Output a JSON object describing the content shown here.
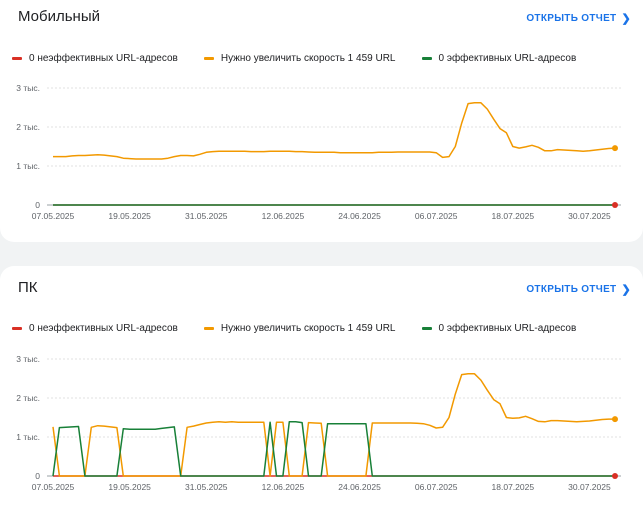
{
  "colors": {
    "red": "#d93025",
    "orange": "#f29900",
    "green": "#188038",
    "link": "#1a73e8"
  },
  "cards": [
    {
      "title": "Мобильный",
      "open_report": "ОТКРЫТЬ ОТЧЕТ",
      "legend": [
        {
          "label": "0 неэффективных URL-адресов",
          "color": "#d93025"
        },
        {
          "label": "Нужно увеличить скорость 1 459 URL",
          "color": "#f29900"
        },
        {
          "label": "0 эффективных URL-адресов",
          "color": "#188038"
        }
      ]
    },
    {
      "title": "ПК",
      "open_report": "ОТКРЫТЬ ОТЧЕТ",
      "legend": [
        {
          "label": "0 неэффективных URL-адресов",
          "color": "#d93025"
        },
        {
          "label": "Нужно увеличить скорость 1 459 URL",
          "color": "#f29900"
        },
        {
          "label": "0 эффективных URL-адресов",
          "color": "#188038"
        }
      ]
    }
  ],
  "chart_data": [
    {
      "type": "line",
      "ylim": [
        0,
        3000
      ],
      "y_ticks": [
        {
          "value": 0,
          "label": "0"
        },
        {
          "value": 1000,
          "label": "1 тыс."
        },
        {
          "value": 2000,
          "label": "2 тыс."
        },
        {
          "value": 3000,
          "label": "3 тыс."
        }
      ],
      "x_tick_labels": [
        "07.05.2025",
        "19.05.2025",
        "31.05.2025",
        "12.06.2025",
        "24.06.2025",
        "06.07.2025",
        "18.07.2025",
        "30.07.2025"
      ],
      "x_tick_index": [
        0,
        12,
        24,
        36,
        48,
        60,
        72,
        84
      ],
      "n_points": 89,
      "series": [
        {
          "name": "0 неэффективных URL-адресов",
          "color": "#d93025",
          "values": [
            0,
            0,
            0,
            0,
            0,
            0,
            0,
            0,
            0,
            0,
            0,
            0,
            0,
            0,
            0,
            0,
            0,
            0,
            0,
            0,
            0,
            0,
            0,
            0,
            0,
            0,
            0,
            0,
            0,
            0,
            0,
            0,
            0,
            0,
            0,
            0,
            0,
            0,
            0,
            0,
            0,
            0,
            0,
            0,
            0,
            0,
            0,
            0,
            0,
            0,
            0,
            0,
            0,
            0,
            0,
            0,
            0,
            0,
            0,
            0,
            0,
            0,
            0,
            0,
            0,
            0,
            0,
            0,
            0,
            0,
            0,
            0,
            0,
            0,
            0,
            0,
            0,
            0,
            0,
            0,
            0,
            0,
            0,
            0,
            0,
            0,
            0,
            0,
            0
          ]
        },
        {
          "name": "Нужно увеличить скорость 1 459 URL",
          "color": "#f29900",
          "values": [
            1240,
            1240,
            1240,
            1260,
            1270,
            1270,
            1280,
            1290,
            1280,
            1260,
            1240,
            1200,
            1190,
            1180,
            1180,
            1180,
            1180,
            1180,
            1200,
            1240,
            1270,
            1270,
            1260,
            1300,
            1350,
            1370,
            1380,
            1380,
            1380,
            1380,
            1380,
            1370,
            1370,
            1370,
            1380,
            1380,
            1380,
            1380,
            1370,
            1370,
            1360,
            1350,
            1350,
            1350,
            1350,
            1340,
            1340,
            1340,
            1340,
            1340,
            1340,
            1350,
            1350,
            1350,
            1360,
            1360,
            1360,
            1360,
            1360,
            1360,
            1340,
            1220,
            1240,
            1500,
            2100,
            2600,
            2620,
            2620,
            2460,
            2200,
            1960,
            1850,
            1500,
            1460,
            1490,
            1530,
            1480,
            1390,
            1390,
            1420,
            1410,
            1400,
            1390,
            1380,
            1390,
            1410,
            1430,
            1450,
            1459
          ]
        },
        {
          "name": "0 эффективных URL-адресов",
          "color": "#188038",
          "values": [
            0,
            0,
            0,
            0,
            0,
            0,
            0,
            0,
            0,
            0,
            0,
            0,
            0,
            0,
            0,
            0,
            0,
            0,
            0,
            0,
            0,
            0,
            0,
            0,
            0,
            0,
            0,
            0,
            0,
            0,
            0,
            0,
            0,
            0,
            0,
            0,
            0,
            0,
            0,
            0,
            0,
            0,
            0,
            0,
            0,
            0,
            0,
            0,
            0,
            0,
            0,
            0,
            0,
            0,
            0,
            0,
            0,
            0,
            0,
            0,
            0,
            0,
            0,
            0,
            0,
            0,
            0,
            0,
            0,
            0,
            0,
            0,
            0,
            0,
            0,
            0,
            0,
            0,
            0,
            0,
            0,
            0,
            0,
            0,
            0,
            0,
            0,
            0,
            0
          ]
        }
      ]
    },
    {
      "type": "line",
      "ylim": [
        0,
        3000
      ],
      "y_ticks": [
        {
          "value": 0,
          "label": "0"
        },
        {
          "value": 1000,
          "label": "1 тыс."
        },
        {
          "value": 2000,
          "label": "2 тыс."
        },
        {
          "value": 3000,
          "label": "3 тыс."
        }
      ],
      "x_tick_labels": [
        "07.05.2025",
        "19.05.2025",
        "31.05.2025",
        "12.06.2025",
        "24.06.2025",
        "06.07.2025",
        "18.07.2025",
        "30.07.2025"
      ],
      "x_tick_index": [
        0,
        12,
        24,
        36,
        48,
        60,
        72,
        84
      ],
      "n_points": 89,
      "series": [
        {
          "name": "0 неэффективных URL-адресов",
          "color": "#d93025",
          "values": [
            0,
            0,
            0,
            0,
            0,
            0,
            0,
            0,
            0,
            0,
            0,
            0,
            0,
            0,
            0,
            0,
            0,
            0,
            0,
            0,
            0,
            0,
            0,
            0,
            0,
            0,
            0,
            0,
            0,
            0,
            0,
            0,
            0,
            0,
            0,
            0,
            0,
            0,
            0,
            0,
            0,
            0,
            0,
            0,
            0,
            0,
            0,
            0,
            0,
            0,
            0,
            0,
            0,
            0,
            0,
            0,
            0,
            0,
            0,
            0,
            0,
            0,
            0,
            0,
            0,
            0,
            0,
            0,
            0,
            0,
            0,
            0,
            0,
            0,
            0,
            0,
            0,
            0,
            0,
            0,
            0,
            0,
            0,
            0,
            0,
            0,
            0,
            0,
            0
          ]
        },
        {
          "name": "Нужно увеличить скорость 1 459 URL",
          "color": "#f29900",
          "values": [
            1260,
            0,
            0,
            0,
            0,
            0,
            1250,
            1290,
            1280,
            1260,
            1240,
            0,
            0,
            0,
            0,
            0,
            0,
            0,
            0,
            0,
            0,
            1250,
            1280,
            1320,
            1360,
            1380,
            1390,
            1380,
            1390,
            1380,
            1380,
            1380,
            1380,
            1380,
            0,
            1380,
            1380,
            0,
            0,
            0,
            1370,
            1360,
            1350,
            0,
            0,
            0,
            0,
            0,
            0,
            0,
            1360,
            1360,
            1360,
            1360,
            1360,
            1360,
            1360,
            1350,
            1340,
            1300,
            1230,
            1250,
            1500,
            2100,
            2600,
            2620,
            2620,
            2460,
            2200,
            1960,
            1850,
            1500,
            1480,
            1490,
            1530,
            1470,
            1400,
            1390,
            1420,
            1420,
            1410,
            1400,
            1390,
            1400,
            1410,
            1430,
            1450,
            1460,
            1459
          ]
        },
        {
          "name": "0 эффективных URL-адресов",
          "color": "#188038",
          "values": [
            0,
            1240,
            1250,
            1260,
            1270,
            0,
            0,
            0,
            0,
            0,
            0,
            1210,
            1200,
            1200,
            1200,
            1200,
            1200,
            1220,
            1240,
            1260,
            0,
            0,
            0,
            0,
            0,
            0,
            0,
            0,
            0,
            0,
            0,
            0,
            0,
            0,
            1380,
            0,
            0,
            1390,
            1390,
            1370,
            0,
            0,
            0,
            1340,
            1340,
            1340,
            1340,
            1340,
            1340,
            1340,
            0,
            0,
            0,
            0,
            0,
            0,
            0,
            0,
            0,
            0,
            0,
            0,
            0,
            0,
            0,
            0,
            0,
            0,
            0,
            0,
            0,
            0,
            0,
            0,
            0,
            0,
            0,
            0,
            0,
            0,
            0,
            0,
            0,
            0,
            0,
            0,
            0,
            0,
            0
          ]
        }
      ]
    }
  ]
}
